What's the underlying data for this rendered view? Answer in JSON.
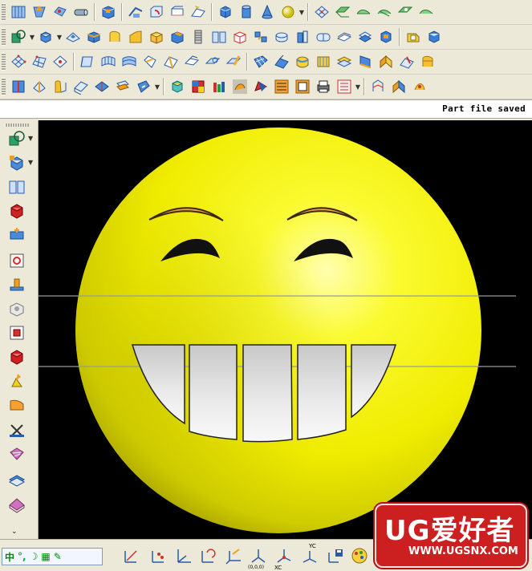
{
  "status": {
    "message": "Part file saved"
  },
  "toolbars": {
    "row1": [
      "point-icon",
      "datum-axis-icon",
      "datum-plane-icon",
      "tube-icon",
      "cylinder-icon",
      "block-icon",
      "extrude-icon",
      "revolve-icon",
      "sweep-icon",
      "cube-icon",
      "cylinder-primitive-icon",
      "cone-icon",
      "sphere-icon",
      "mesh-icon",
      "surface-icon",
      "surface-icon",
      "surface-icon",
      "surface-icon",
      "surface-icon"
    ],
    "row2": [
      "sketch-icon",
      "box-icon",
      "face-icon",
      "block-icon",
      "sweep-icon",
      "blend-icon",
      "shell-icon",
      "chamfer-icon",
      "thread-icon",
      "book-icon",
      "hollow-icon",
      "pattern-icon",
      "mirror-icon",
      "cylinder-icon",
      "trim-icon",
      "offset-icon",
      "sew-icon",
      "cube-icon",
      "extract-icon"
    ],
    "row3": [
      "through-curves-icon",
      "through-curve-mesh-icon",
      "ruled-icon",
      "swept-icon",
      "sectional-icon",
      "bridge-icon",
      "n-sided-icon",
      "law-extension-icon",
      "offset-face-icon",
      "trim-body-icon",
      "edit-icon",
      "mesh-icon",
      "flange-icon",
      "emboss-icon",
      "x-form-icon",
      "i-form-icon",
      "patch-icon",
      "bend-icon"
    ],
    "row4": [
      "sheet-metal-icon",
      "tab-icon",
      "flange-icon",
      "contour-flange-icon",
      "bead-icon",
      "louver-icon",
      "drawn-cutout-icon",
      "shaded-icon",
      "face-analysis-icon",
      "reflection-icon",
      "curvature-icon",
      "deviation-icon",
      "check-icon",
      "print-icon",
      "export-icon",
      "more-icon",
      "view-icon",
      "render-icon"
    ]
  },
  "left_toolbar": {
    "tools": [
      "sketch-icon",
      "extrude-icon",
      "revolve-icon",
      "block-icon",
      "move-icon",
      "hole-icon",
      "boss-icon",
      "pocket-icon",
      "pad-icon",
      "edge-blend-icon",
      "draft-icon",
      "face-icon",
      "trim-body-icon",
      "sew-icon",
      "mesh-surface-icon",
      "thicken-icon",
      "offset-surface-icon"
    ]
  },
  "bottom_toolbar": {
    "ime": {
      "lang": "中",
      "punct": "°,"
    },
    "tools": [
      "line-icon",
      "point-set-icon",
      "axis-icon",
      "rotate-wcs-icon",
      "orient-wcs-icon",
      "origin-icon",
      "xc-icon",
      "yc-icon",
      "save-wcs-icon",
      "paint-icon",
      "select-icon",
      "filter-icon"
    ],
    "origin_label": "(0,0,0)",
    "xc_label": "XC",
    "yc_label": "YC"
  },
  "watermark": {
    "logo": "UG爱好者",
    "url": "WWW.UGSNX.COM"
  },
  "colors": {
    "face": "#f5f000",
    "teeth": "#e8e8e8",
    "eyebrow": "#d85a4a",
    "background": "#000000"
  }
}
